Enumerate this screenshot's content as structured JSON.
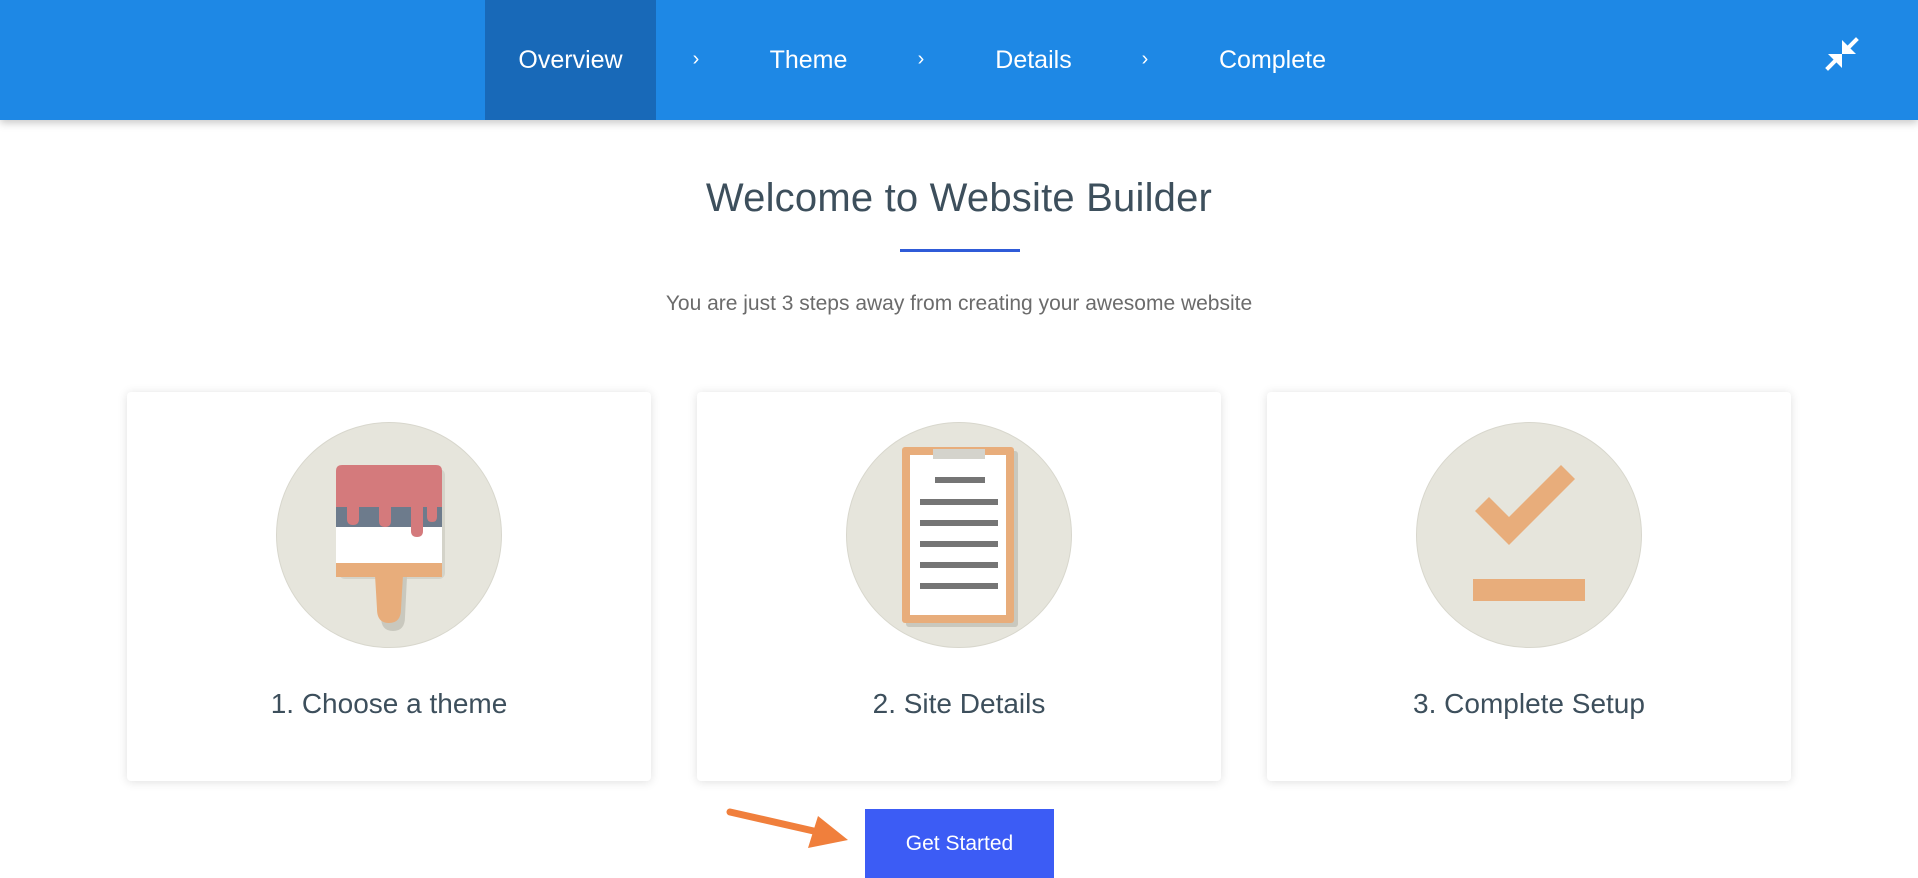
{
  "nav": {
    "steps": [
      {
        "label": "Overview",
        "active": true
      },
      {
        "label": "Theme",
        "active": false
      },
      {
        "label": "Details",
        "active": false
      },
      {
        "label": "Complete",
        "active": false
      }
    ],
    "separator": "›",
    "collapse_icon": "collapse-arrows-icon"
  },
  "header": {
    "title": "Welcome to Website Builder",
    "subtitle": "You are just 3 steps away from creating your awesome website"
  },
  "cards": [
    {
      "label": "1. Choose a theme",
      "icon": "paint-brush-icon"
    },
    {
      "label": "2. Site Details",
      "icon": "clipboard-icon"
    },
    {
      "label": "3. Complete Setup",
      "icon": "checkmark-icon"
    }
  ],
  "cta": {
    "label": "Get Started",
    "annotation_icon": "pointer-arrow-icon"
  },
  "colors": {
    "nav_bg": "#1e88e5",
    "nav_active_bg": "#1869b8",
    "button_bg": "#3c5cf5",
    "icon_circle": "#e6e5dc",
    "icon_accent": "#e8ad7b",
    "arrow": "#f07f3c"
  }
}
